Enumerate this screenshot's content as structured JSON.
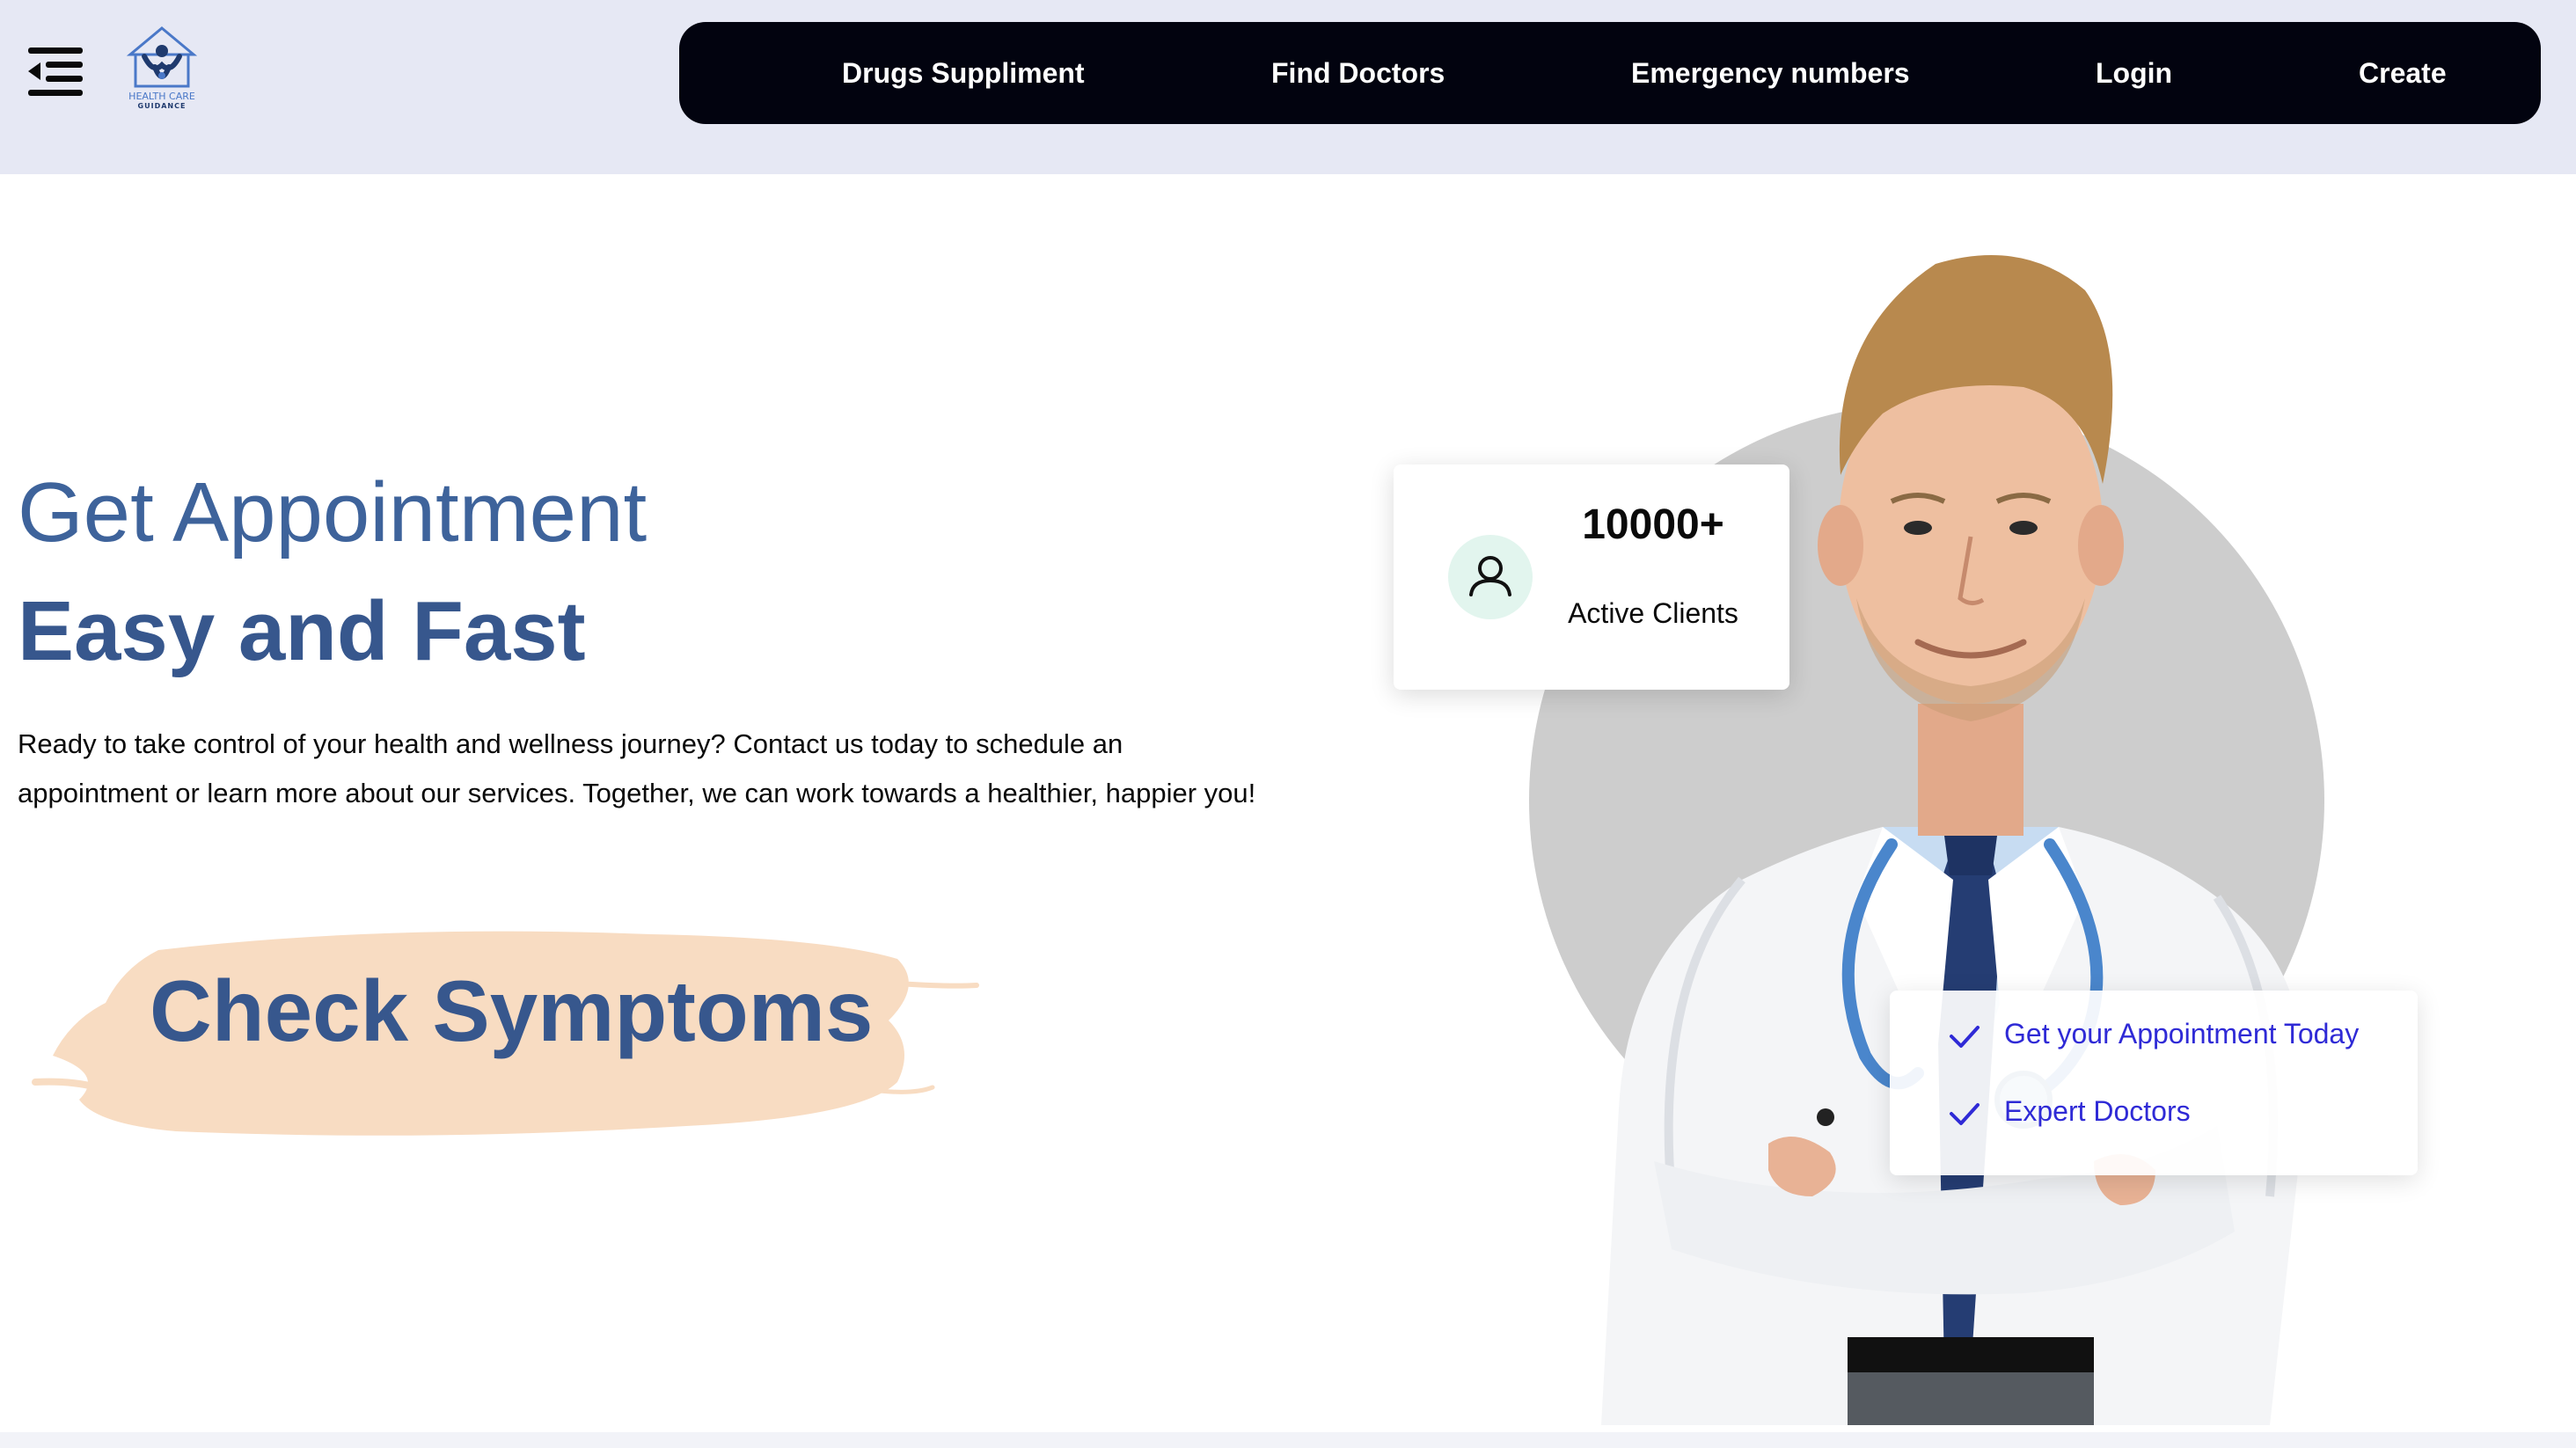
{
  "header": {
    "logo": {
      "line1": "HEALTH CARE",
      "line2": "GUIDANCE"
    },
    "nav": [
      {
        "label": "Drugs Suppliment"
      },
      {
        "label": "Find Doctors"
      },
      {
        "label": "Emergency numbers"
      },
      {
        "label": "Login"
      },
      {
        "label": "Create"
      }
    ]
  },
  "hero": {
    "title_line1": "Get Appointment",
    "title_line2": "Easy and Fast",
    "description": "Ready to take control of your health and wellness journey? Contact us today to schedule an appointment or learn more about our services. Together, we can work towards a healthier, happier you!",
    "cta_label": "Check Symptoms"
  },
  "stats": {
    "number": "10000+",
    "label": "Active Clients"
  },
  "features": [
    {
      "text": "Get your Appointment Today"
    },
    {
      "text": "Expert Doctors"
    }
  ],
  "colors": {
    "header_bg": "#e6e8f4",
    "nav_bg": "#02030f",
    "heading_blue": "#37578d",
    "feature_text": "#2f2ad6",
    "brush": "#f8dcc2",
    "circle": "#cdcdcd",
    "stat_icon_bg": "#e2f5ee"
  },
  "icons": {
    "menu": "menu-collapse-icon",
    "stat": "user-icon",
    "feature": "checkmark-icon"
  }
}
